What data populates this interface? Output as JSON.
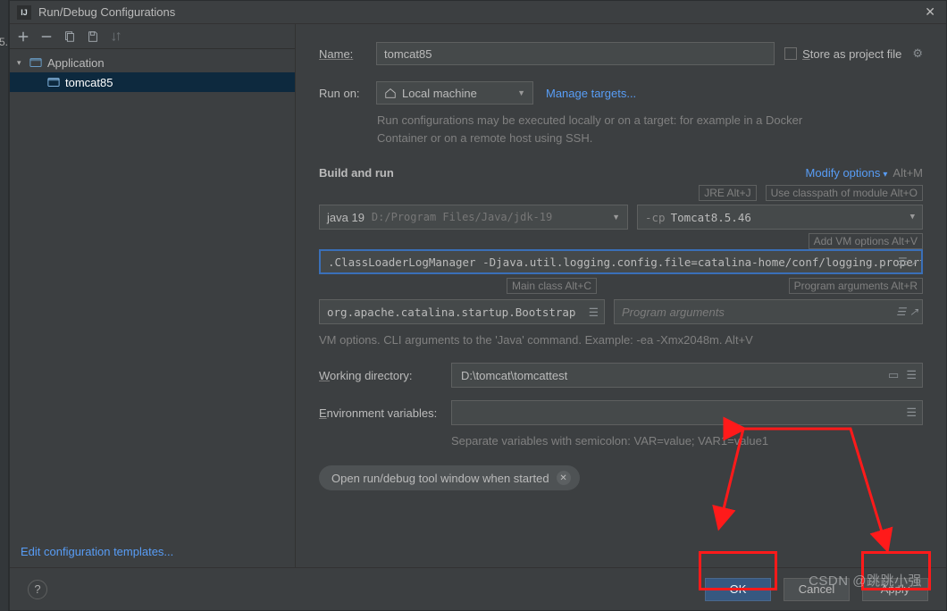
{
  "window": {
    "title": "Run/Debug Configurations"
  },
  "tree": {
    "root": "Application",
    "child": "tomcat85"
  },
  "sidebar": {
    "edit_templates": "Edit configuration templates..."
  },
  "form": {
    "name_label": "Name:",
    "name_value": "tomcat85",
    "store_label": "Store as project file",
    "run_on_label": "Run on:",
    "run_on_value": "Local machine",
    "manage_targets": "Manage targets...",
    "run_on_hint": "Run configurations may be executed locally or on a target: for example in a Docker Container or on a remote host using SSH.",
    "section": "Build and run",
    "modify_options": "Modify options",
    "modify_shortcut": "Alt+M",
    "jre_tag": "JRE Alt+J",
    "classpath_tag": "Use classpath of module Alt+O",
    "jdk_name": "java 19",
    "jdk_path": "D:/Program Files/Java/jdk-19",
    "cp_prefix": "-cp",
    "cp_value": "Tomcat8.5.46",
    "vm_options_tag": "Add VM options Alt+V",
    "vm_value": ".ClassLoaderLogManager -Djava.util.logging.config.file=catalina-home/conf/logging.properties",
    "main_class_tag": "Main class Alt+C",
    "prog_args_tag": "Program arguments Alt+R",
    "main_class": "org.apache.catalina.startup.Bootstrap",
    "prog_args_placeholder": "Program arguments",
    "vm_hint": "VM options. CLI arguments to the 'Java' command. Example: -ea -Xmx2048m. Alt+V",
    "wd_label": "Working directory:",
    "wd_value": "D:\\tomcat\\tomcattest",
    "env_label": "Environment variables:",
    "env_hint": "Separate variables with semicolon: VAR=value; VAR1=value1",
    "pill": "Open run/debug tool window when started"
  },
  "footer": {
    "ok": "OK",
    "cancel": "Cancel",
    "apply": "Apply"
  },
  "watermark": "CSDN @跳跳小强"
}
